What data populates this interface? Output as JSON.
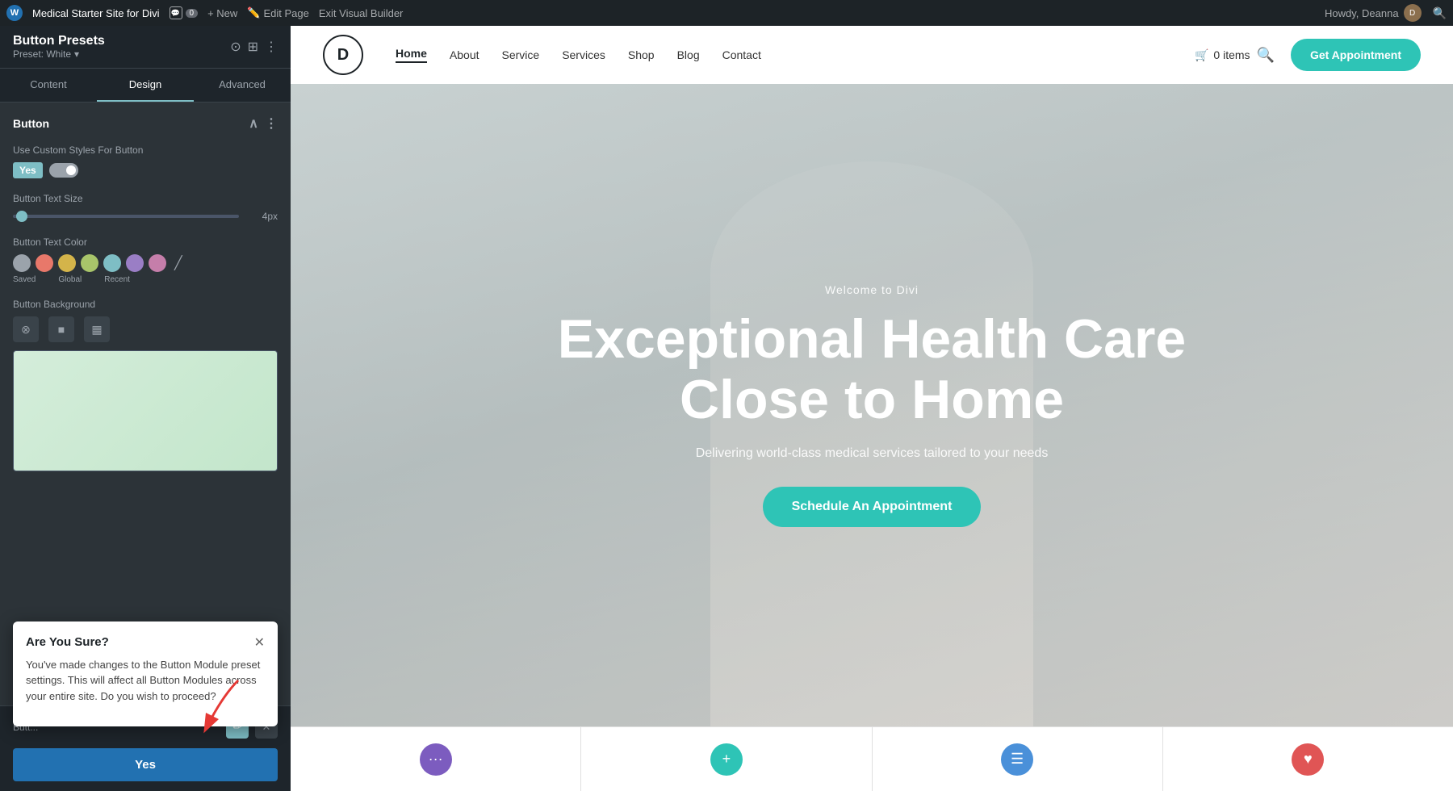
{
  "adminBar": {
    "wpLogo": "W",
    "siteName": "Medical Starter Site for Divi",
    "commentsCount": "0",
    "newLabel": "+ New",
    "editPageLabel": "Edit Page",
    "exitBuilderLabel": "Exit Visual Builder",
    "howdyLabel": "Howdy, Deanna",
    "searchIcon": "🔍"
  },
  "sidebar": {
    "title": "Button Presets",
    "preset": "Preset: White",
    "presetDropdown": "▾",
    "icons": [
      "⊙",
      "⊞",
      "⋮"
    ],
    "tabs": [
      {
        "label": "Content",
        "id": "content"
      },
      {
        "label": "Design",
        "id": "design",
        "active": true
      },
      {
        "label": "Advanced",
        "id": "advanced"
      }
    ],
    "sectionTitle": "Button",
    "fields": {
      "customStylesLabel": "Use Custom Styles For Button",
      "toggleYes": "Yes",
      "buttonTextSizeLabel": "Button Text Size",
      "sliderValue": "4px",
      "buttonTextColorLabel": "Button Text Color",
      "buttonBackgroundLabel": "Button Background"
    },
    "colorLabels": [
      "Saved",
      "Global",
      "Recent"
    ],
    "confirmDialog": {
      "title": "Are You Sure?",
      "body": "You've made changes to the Button Module preset settings. This will affect all Button Modules across your entire site. Do you wish to proceed?",
      "yesLabel": "Yes"
    },
    "footer": {
      "buttonLabel": "Butt..."
    }
  },
  "website": {
    "logoLetter": "D",
    "nav": {
      "links": [
        {
          "label": "Home",
          "active": true
        },
        {
          "label": "About"
        },
        {
          "label": "Service"
        },
        {
          "label": "Services"
        },
        {
          "label": "Shop"
        },
        {
          "label": "Blog"
        },
        {
          "label": "Contact"
        }
      ],
      "cartLabel": "0 items",
      "searchIcon": "🔍",
      "getApptLabel": "Get Appointment"
    },
    "hero": {
      "subtitle": "Welcome to Divi",
      "title": "Exceptional Health Care Close to Home",
      "description": "Delivering world-class medical services tailored to your needs",
      "ctaLabel": "Schedule An Appointment"
    },
    "bottomCards": [
      {
        "icon": "···",
        "iconClass": "purple"
      },
      {
        "icon": "+",
        "iconClass": "teal"
      },
      {
        "icon": "☰",
        "iconClass": "blue"
      },
      {
        "icon": "♥",
        "iconClass": "red"
      }
    ]
  }
}
